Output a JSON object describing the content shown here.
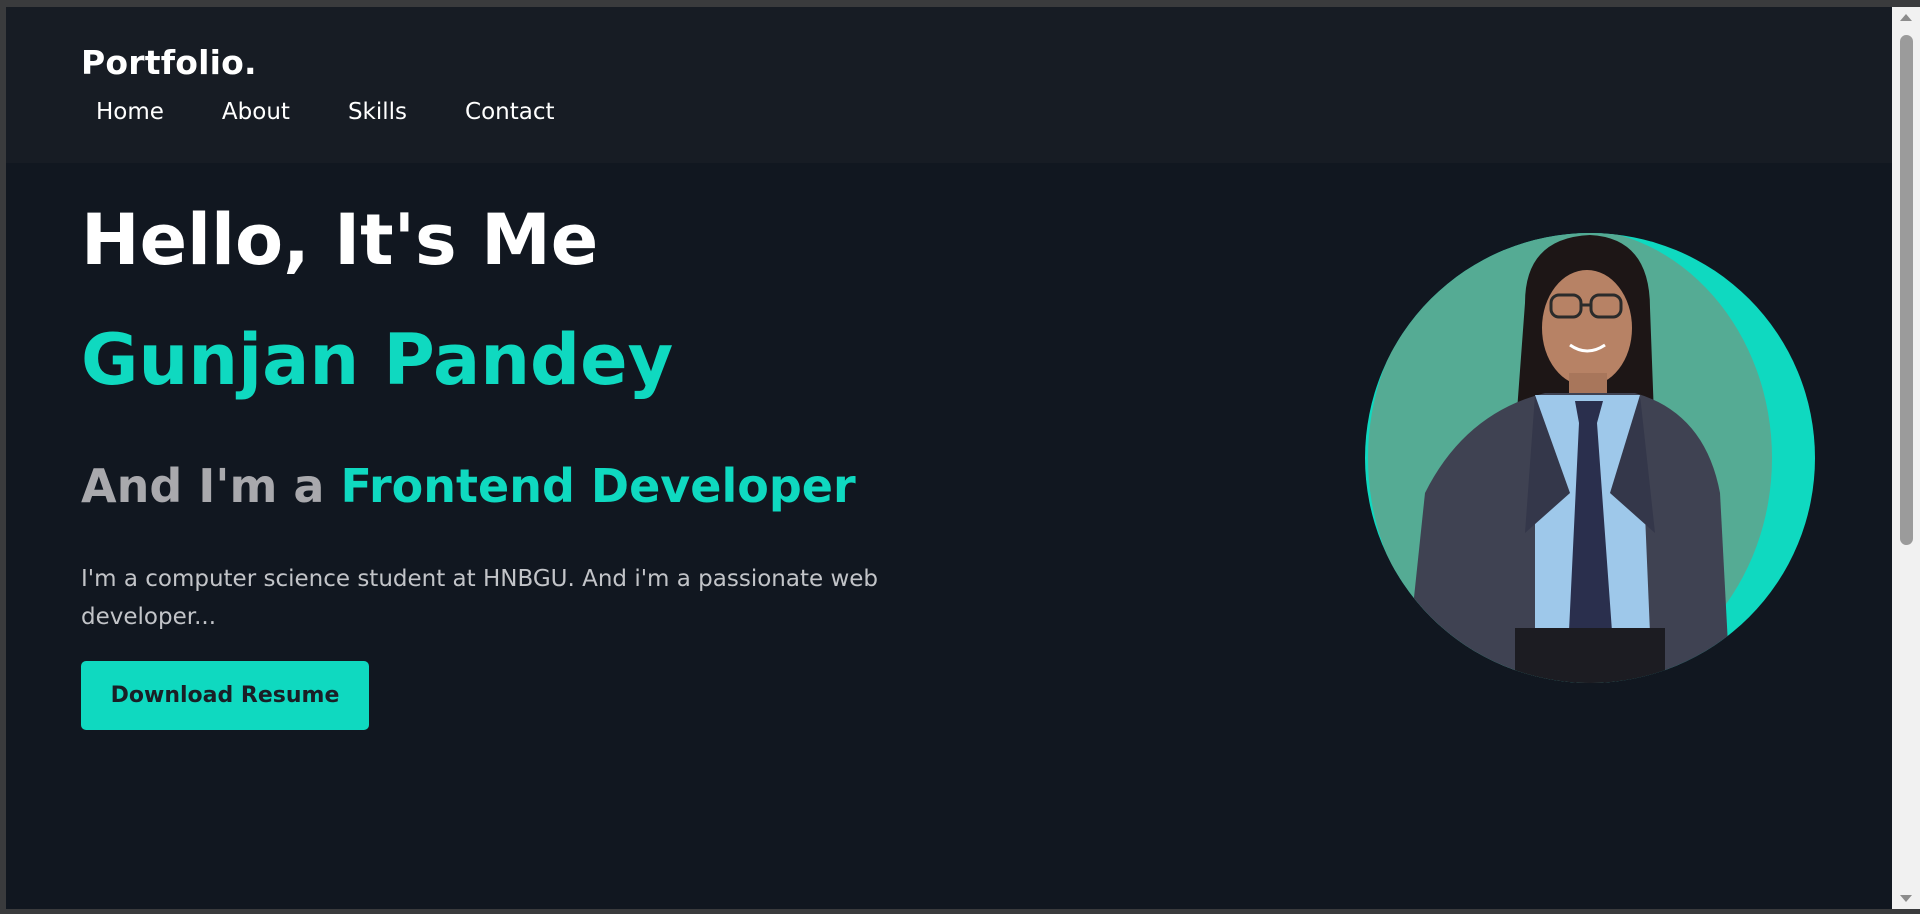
{
  "header": {
    "logo": "Portfolio.",
    "nav": [
      {
        "label": "Home"
      },
      {
        "label": "About"
      },
      {
        "label": "Skills"
      },
      {
        "label": "Contact"
      }
    ]
  },
  "hero": {
    "greeting": "Hello, It's Me",
    "name": "Gunjan Pandey",
    "role_prefix": "And I'm a ",
    "role_highlight": "Frontend Developer",
    "description": "I'm a computer science student at HNBGU. And i'm a passionate web developer...",
    "button_label": "Download Resume"
  },
  "colors": {
    "accent": "#0fd9c0",
    "background": "#111720",
    "header_bg": "#171c24"
  }
}
